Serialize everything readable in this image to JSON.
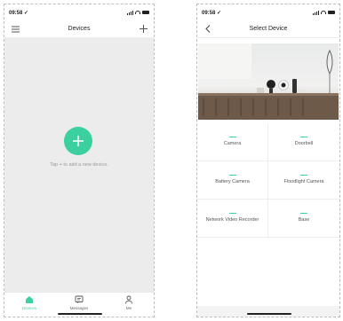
{
  "left_phone": {
    "status": {
      "time": "09:58 ✓"
    },
    "nav": {
      "title": "Devices"
    },
    "main": {
      "hint": "Tap + to add a new device."
    },
    "tabs": [
      {
        "label": "Devices",
        "icon": "home-icon",
        "active": true
      },
      {
        "label": "Messages",
        "icon": "message-icon",
        "active": false
      },
      {
        "label": "Me",
        "icon": "person-icon",
        "active": false
      }
    ]
  },
  "right_phone": {
    "status": {
      "time": "09:58 ✓"
    },
    "nav": {
      "title": "Select Device"
    },
    "hero": {
      "image": "living-room-devices-photo"
    },
    "device_types": [
      {
        "label": "Camera"
      },
      {
        "label": "Doorbell"
      },
      {
        "label": "Battery Camera"
      },
      {
        "label": "Floodlight Camera"
      },
      {
        "label": "Network Video Recorder"
      },
      {
        "label": "Base"
      }
    ]
  },
  "colors": {
    "accent": "#3ccfa0",
    "background": "#ececec",
    "text": "#222222"
  }
}
